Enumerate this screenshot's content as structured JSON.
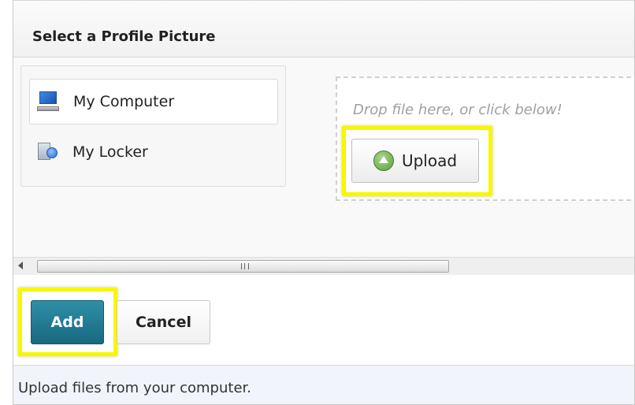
{
  "dialog": {
    "title": "Select a Profile Picture"
  },
  "sources": {
    "items": [
      {
        "label": "My Computer",
        "icon": "computer-icon",
        "selected": true
      },
      {
        "label": "My Locker",
        "icon": "locker-icon",
        "selected": false
      }
    ]
  },
  "dropzone": {
    "text": "Drop file here, or click below!",
    "upload_label": "Upload",
    "upload_icon": "upload-arrow-icon"
  },
  "scrollbar": {
    "left_arrow_icon": "left-arrow-icon",
    "grip_icon": "grip-icon"
  },
  "actions": {
    "add_label": "Add",
    "cancel_label": "Cancel"
  },
  "status": {
    "text": "Upload files from your computer."
  },
  "colors": {
    "highlight": "#f7f700",
    "primary_button": "#1f7890",
    "status_bar": "#f1f4fa"
  }
}
